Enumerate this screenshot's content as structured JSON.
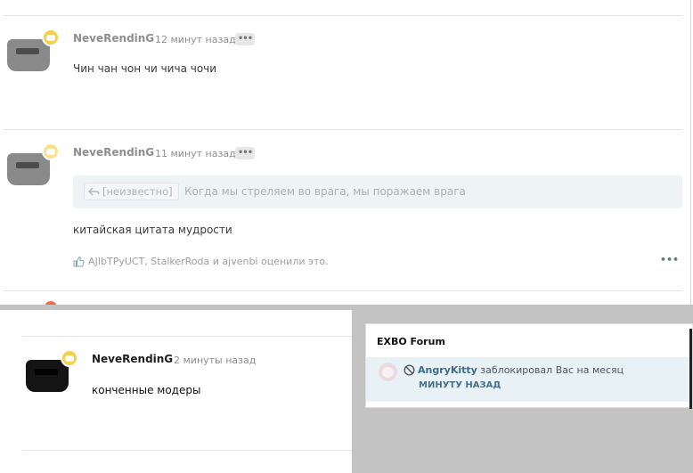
{
  "post1": {
    "author": "NeveRendinG",
    "time": "12 минут назад",
    "menu": "•••",
    "text": "Чин чан чон чи чича чочи"
  },
  "post2": {
    "author": "NeveRendinG",
    "time": "11 минут назад",
    "menu": "•••",
    "quote": {
      "source": "[неизвестно]",
      "text": "Когда мы стреляем во врага, мы поражаем врага"
    },
    "text": "китайская цитата мудрости",
    "likes": "AJIbTPyUCT, StalkerRoda и ajvenbi оценили это.",
    "more": "•••"
  },
  "post3": {
    "author": "NeveRendinG",
    "time": "2 минуты назад",
    "text": "конченные модеры"
  },
  "notification": {
    "header": "EXBO Forum",
    "user": "AngryKitty",
    "message": "заблокировал Вас на месяц",
    "time": "МИНУТУ НАЗАД"
  },
  "icons": {
    "avatar": "sunglasses-avatar-icon",
    "badge": "speech-bubble-badge-icon",
    "reply": "reply-arrow-icon",
    "like": "thumbs-up-icon",
    "ban": "ban-icon"
  },
  "colors": {
    "badge": "#f5cf4d",
    "quote_bg": "#eef4f6",
    "notif_bg": "#e8f1f5",
    "link": "#3f6c89"
  }
}
